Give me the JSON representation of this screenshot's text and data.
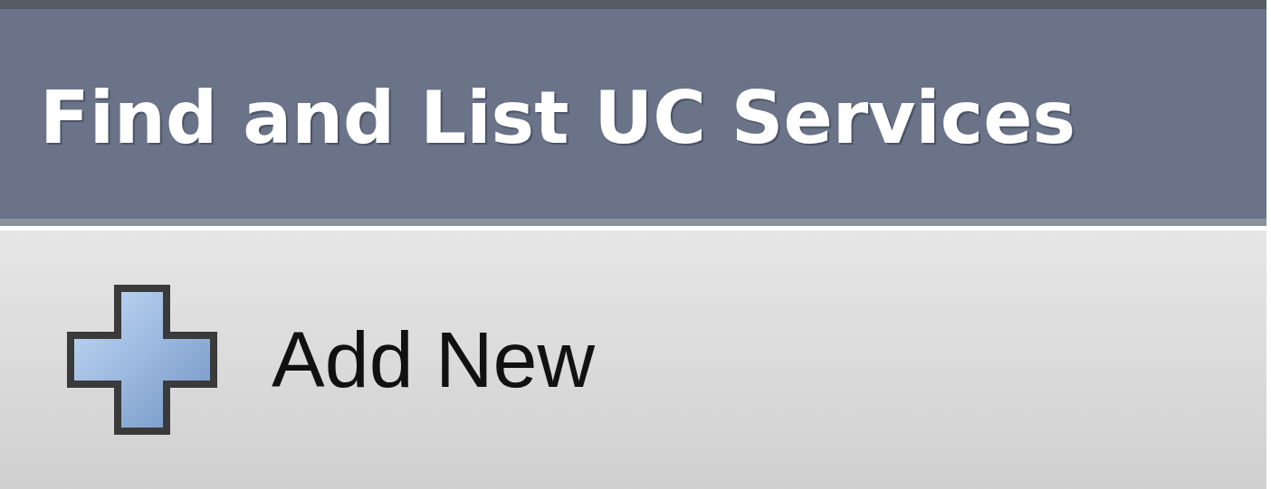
{
  "header": {
    "title": "Find and List UC Services"
  },
  "toolbar": {
    "buttons": [
      {
        "kind": "add",
        "label": "Add New"
      }
    ]
  }
}
